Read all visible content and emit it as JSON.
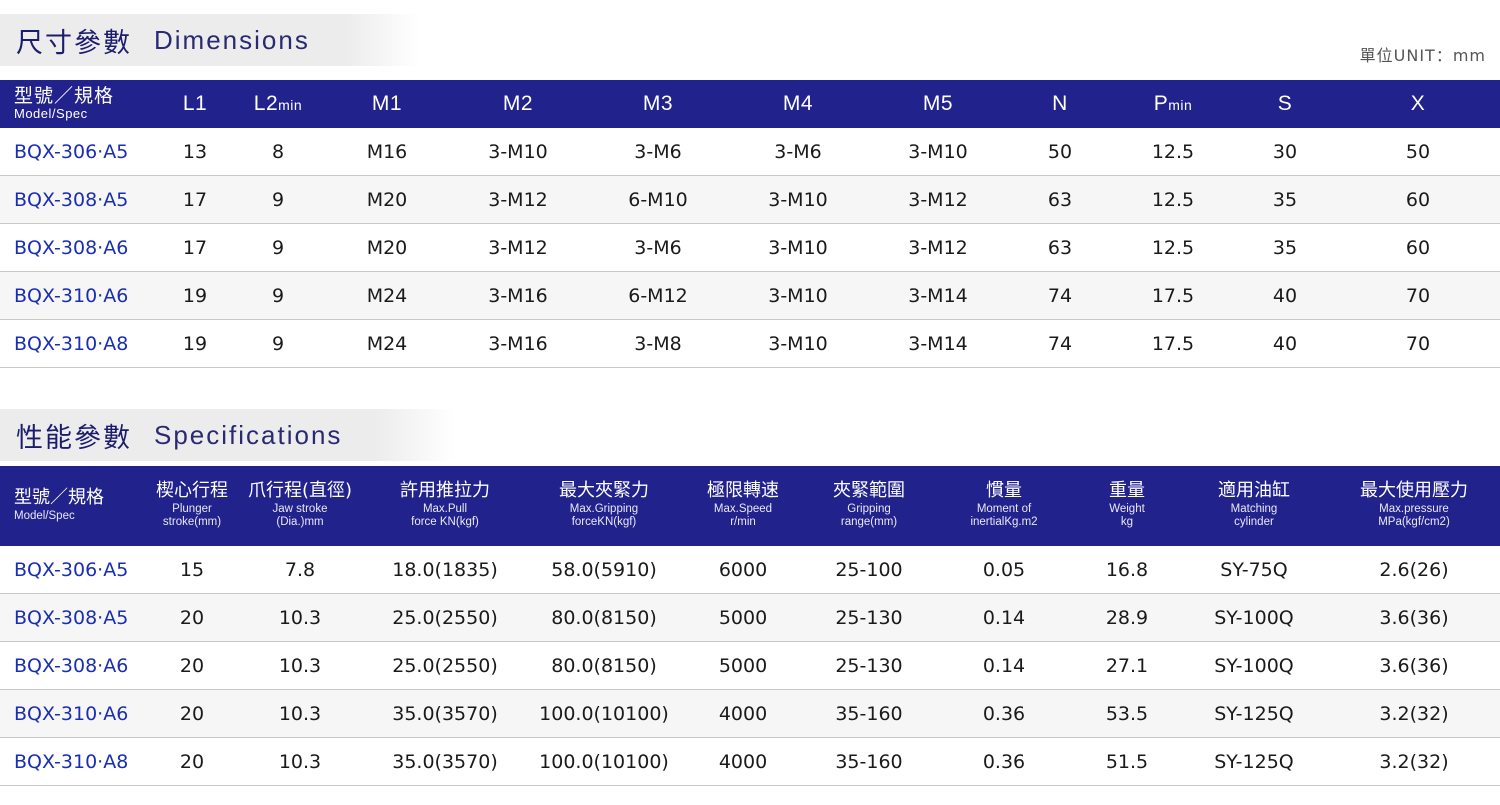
{
  "dimensions_section": {
    "title_cn": "尺寸參數",
    "title_en": "Dimensions",
    "unit_label": "單位UNIT：mm",
    "headers": [
      {
        "cn": "型號／規格",
        "en": "Model/Spec"
      },
      {
        "cn": "L1",
        "en": ""
      },
      {
        "cn": "L2",
        "en": "min"
      },
      {
        "cn": "M1",
        "en": ""
      },
      {
        "cn": "M2",
        "en": ""
      },
      {
        "cn": "M3",
        "en": ""
      },
      {
        "cn": "M4",
        "en": ""
      },
      {
        "cn": "M5",
        "en": ""
      },
      {
        "cn": "N",
        "en": ""
      },
      {
        "cn": "P",
        "en": "min"
      },
      {
        "cn": "S",
        "en": ""
      },
      {
        "cn": "X",
        "en": ""
      }
    ],
    "rows": [
      [
        "BQX-306·A5",
        "13",
        "8",
        "M16",
        "3-M10",
        "3-M6",
        "3-M6",
        "3-M10",
        "50",
        "12.5",
        "30",
        "50"
      ],
      [
        "BQX-308·A5",
        "17",
        "9",
        "M20",
        "3-M12",
        "6-M10",
        "3-M10",
        "3-M12",
        "63",
        "12.5",
        "35",
        "60"
      ],
      [
        "BQX-308·A6",
        "17",
        "9",
        "M20",
        "3-M12",
        "3-M6",
        "3-M10",
        "3-M12",
        "63",
        "12.5",
        "35",
        "60"
      ],
      [
        "BQX-310·A6",
        "19",
        "9",
        "M24",
        "3-M16",
        "6-M12",
        "3-M10",
        "3-M14",
        "74",
        "17.5",
        "40",
        "70"
      ],
      [
        "BQX-310·A8",
        "19",
        "9",
        "M24",
        "3-M16",
        "3-M8",
        "3-M10",
        "3-M14",
        "74",
        "17.5",
        "40",
        "70"
      ]
    ]
  },
  "specifications_section": {
    "title_cn": "性能參數",
    "title_en": "Specifications",
    "headers": [
      {
        "cn": "型號／規格",
        "en1": "Model/Spec",
        "en2": ""
      },
      {
        "cn": "楔心行程",
        "en1": "Plunger",
        "en2": "stroke(mm)"
      },
      {
        "cn": "爪行程(直徑)",
        "en1": "Jaw stroke",
        "en2": "(Dia.)mm"
      },
      {
        "cn": "許用推拉力",
        "en1": "Max.Pull",
        "en2": "force KN(kgf)"
      },
      {
        "cn": "最大夾緊力",
        "en1": "Max.Gripping",
        "en2": "forceKN(kgf)"
      },
      {
        "cn": "極限轉速",
        "en1": "Max.Speed",
        "en2": "r/min"
      },
      {
        "cn": "夾緊範圍",
        "en1": "Gripping",
        "en2": "range(mm)"
      },
      {
        "cn": "慣量",
        "en1": "Moment of",
        "en2": "inertialKg.m2"
      },
      {
        "cn": "重量",
        "en1": "Weight",
        "en2": "kg"
      },
      {
        "cn": "適用油缸",
        "en1": "Matching",
        "en2": "cylinder"
      },
      {
        "cn": "最大使用壓力",
        "en1": "Max.pressure",
        "en2": "MPa(kgf/cm2)"
      }
    ],
    "rows": [
      [
        "BQX-306·A5",
        "15",
        "7.8",
        "18.0(1835)",
        "58.0(5910)",
        "6000",
        "25-100",
        "0.05",
        "16.8",
        "SY-75Q",
        "2.6(26)"
      ],
      [
        "BQX-308·A5",
        "20",
        "10.3",
        "25.0(2550)",
        "80.0(8150)",
        "5000",
        "25-130",
        "0.14",
        "28.9",
        "SY-100Q",
        "3.6(36)"
      ],
      [
        "BQX-308·A6",
        "20",
        "10.3",
        "25.0(2550)",
        "80.0(8150)",
        "5000",
        "25-130",
        "0.14",
        "27.1",
        "SY-100Q",
        "3.6(36)"
      ],
      [
        "BQX-310·A6",
        "20",
        "10.3",
        "35.0(3570)",
        "100.0(10100)",
        "4000",
        "35-160",
        "0.36",
        "53.5",
        "SY-125Q",
        "3.2(32)"
      ],
      [
        "BQX-310·A8",
        "20",
        "10.3",
        "35.0(3570)",
        "100.0(10100)",
        "4000",
        "35-160",
        "0.36",
        "51.5",
        "SY-125Q",
        "3.2(32)"
      ]
    ]
  },
  "colors": {
    "header_blue": "#22228c",
    "model_blue": "#1a2fb0",
    "title_blue": "#1c1c6e",
    "band_gray": "#ececec"
  }
}
